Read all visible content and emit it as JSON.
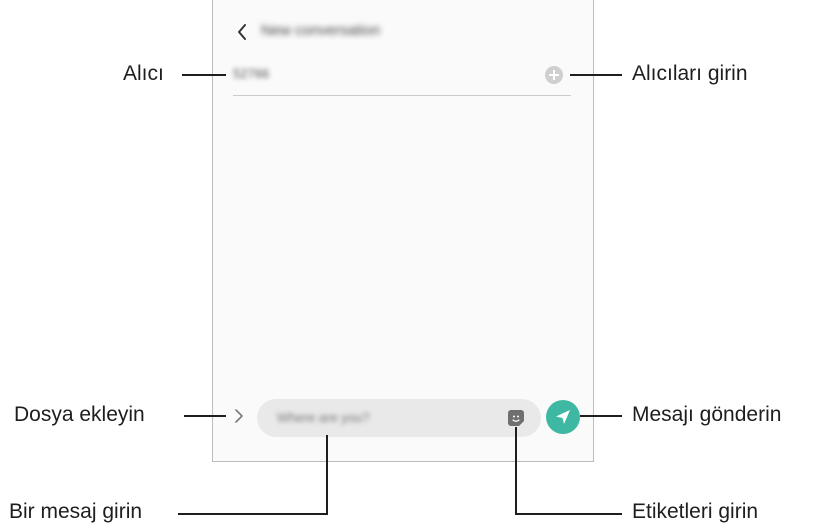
{
  "screen": {
    "title": "New conversation",
    "recipient_value": "52766",
    "message_placeholder": "Where are you?"
  },
  "callouts": {
    "recipient": "Alıcı",
    "enter_recipients": "Alıcıları girin",
    "attach_file": "Dosya ekleyin",
    "send_message": "Mesajı gönderin",
    "enter_message": "Bir mesaj girin",
    "enter_stickers": "Etiketleri girin"
  },
  "icons": {
    "back": "chevron-left-icon",
    "add": "plus-circle-icon",
    "attach": "chevron-right-icon",
    "sticker": "sticker-icon",
    "send": "paper-plane-icon"
  },
  "colors": {
    "send_button": "#3fb8a3",
    "input_background": "#e9e9e9",
    "screen_background": "#fafafa"
  }
}
